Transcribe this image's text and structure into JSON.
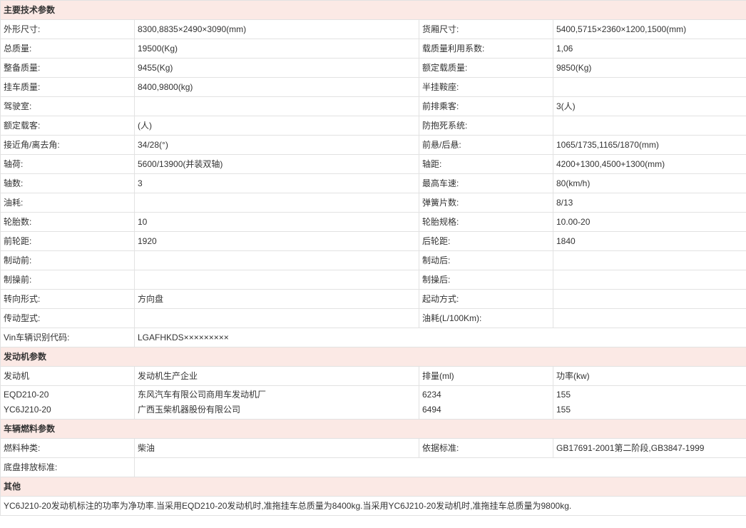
{
  "sections": {
    "main": "主要技术参数",
    "engine": "发动机参数",
    "fuel": "车辆燃料参数",
    "other": "其他"
  },
  "main_rows": [
    [
      "外形尺寸:",
      "8300,8835×2490×3090(mm)",
      "货厢尺寸:",
      "5400,5715×2360×1200,1500(mm)"
    ],
    [
      "总质量:",
      "19500(Kg)",
      "载质量利用系数:",
      "1,06"
    ],
    [
      "整备质量:",
      "9455(Kg)",
      "额定载质量:",
      "9850(Kg)"
    ],
    [
      "挂车质量:",
      "8400,9800(kg)",
      "半挂鞍座:",
      ""
    ],
    [
      "驾驶室:",
      "",
      "前排乘客:",
      "3(人)"
    ],
    [
      "额定载客:",
      "(人)",
      "防抱死系统:",
      ""
    ],
    [
      "接近角/离去角:",
      "34/28(°)",
      "前悬/后悬:",
      "1065/1735,1165/1870(mm)"
    ],
    [
      "轴荷:",
      "5600/13900(并装双轴)",
      "轴距:",
      "4200+1300,4500+1300(mm)"
    ],
    [
      "轴数:",
      "3",
      "最高车速:",
      "80(km/h)"
    ],
    [
      "油耗:",
      "",
      "弹簧片数:",
      "8/13"
    ],
    [
      "轮胎数:",
      "10",
      "轮胎规格:",
      "10.00-20"
    ],
    [
      "前轮距:",
      "1920",
      "后轮距:",
      "1840"
    ],
    [
      "制动前:",
      "",
      "制动后:",
      ""
    ],
    [
      "制操前:",
      "",
      "制操后:",
      ""
    ],
    [
      "转向形式:",
      "方向盘",
      "起动方式:",
      ""
    ],
    [
      "传动型式:",
      "",
      "油耗(L/100Km):",
      ""
    ]
  ],
  "vin": {
    "label": "Vin车辆识别代码:",
    "value": "LGAFHKDS×××××××××"
  },
  "engine": {
    "headers": [
      "发动机",
      "发动机生产企业",
      "排量(ml)",
      "功率(kw)"
    ],
    "rows": [
      [
        "EQD210-20",
        "东风汽车有限公司商用车发动机厂",
        "6234",
        "155"
      ],
      [
        "YC6J210-20",
        "广西玉柴机器股份有限公司",
        "6494",
        "155"
      ]
    ]
  },
  "fuel": {
    "rows": [
      [
        "燃料种类:",
        "柴油",
        "依据标准:",
        "GB17691-2001第二阶段,GB3847-1999"
      ]
    ],
    "chassis_label": "底盘排放标准:",
    "chassis_value": ""
  },
  "other_note": "YC6J210-20发动机标注的功率为净功率.当采用EQD210-20发动机时,准拖挂车总质量为8400kg.当采用YC6J210-20发动机时,准拖挂车总质量为9800kg."
}
